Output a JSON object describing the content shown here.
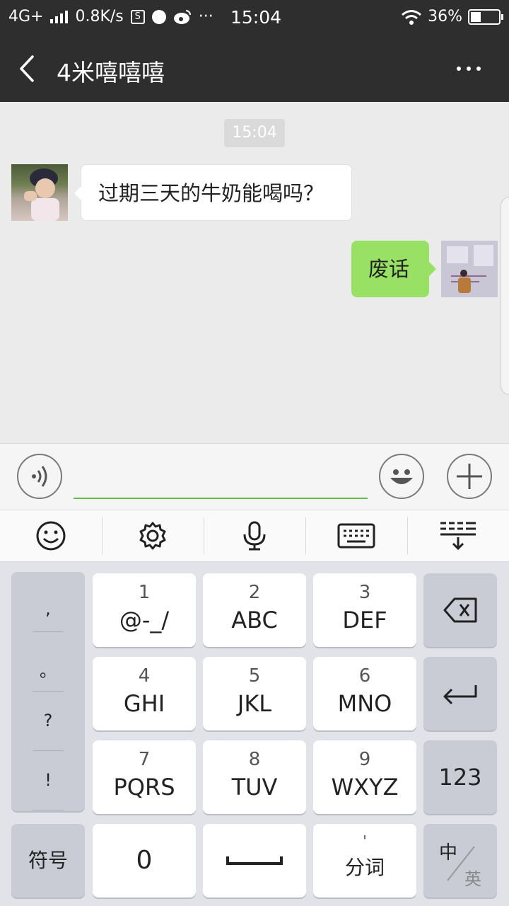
{
  "status_bar": {
    "network": "4G+",
    "speed": "0.8K/s",
    "time": "15:04",
    "battery": "36%",
    "icons": [
      "signal-icon",
      "s-app-icon",
      "circle-app-icon",
      "weibo-icon",
      "more-dots-icon",
      "wifi-icon",
      "battery-icon"
    ]
  },
  "header": {
    "title": "4米嘻嘻嘻",
    "back_icon": "chevron-left-icon",
    "menu_icon": "more-icon"
  },
  "chat": {
    "timestamp": "15:04",
    "messages": [
      {
        "side": "left",
        "text": "过期三天的牛奶能喝吗？"
      },
      {
        "side": "right",
        "text": "废话"
      }
    ]
  },
  "input": {
    "value": "",
    "placeholder": ""
  },
  "toolbar": {
    "items": [
      "smiley-icon",
      "settings-icon",
      "microphone-icon",
      "keyboard-icon",
      "keyboard-hide-icon"
    ]
  },
  "keyboard": {
    "punctuation": [
      ",",
      "。",
      "?",
      "!"
    ],
    "keys": [
      {
        "num": "1",
        "letters": "@-_/"
      },
      {
        "num": "2",
        "letters": "ABC"
      },
      {
        "num": "3",
        "letters": "DEF"
      },
      {
        "num": "4",
        "letters": "GHI"
      },
      {
        "num": "5",
        "letters": "JKL"
      },
      {
        "num": "6",
        "letters": "MNO"
      },
      {
        "num": "7",
        "letters": "PQRS"
      },
      {
        "num": "8",
        "letters": "TUV"
      },
      {
        "num": "9",
        "letters": "WXYZ"
      }
    ],
    "symbols_label": "符号",
    "zero_label": "0",
    "segment_top": "'",
    "segment_label": "分词",
    "numbers_label": "123",
    "lang_zh": "中",
    "lang_en": "英"
  },
  "colors": {
    "header_bg": "#2e2e2e",
    "chat_bg": "#ebebeb",
    "sent_bubble": "#98e165",
    "input_underline": "#5cbf3f",
    "keyboard_bg": "#e1e3e8"
  }
}
